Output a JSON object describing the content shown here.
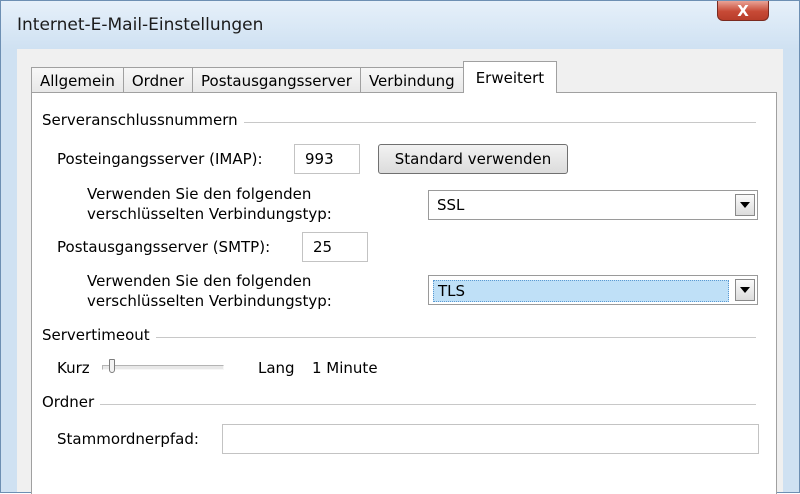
{
  "window": {
    "title": "Internet-E-Mail-Einstellungen",
    "close_symbol": "X"
  },
  "tabs": [
    {
      "label": "Allgemein"
    },
    {
      "label": "Ordner"
    },
    {
      "label": "Postausgangsserver"
    },
    {
      "label": "Verbindung"
    },
    {
      "label": "Erweitert",
      "active": true
    }
  ],
  "ports": {
    "group_title": "Serveranschlussnummern",
    "incoming_label": "Posteingangsserver (IMAP):",
    "incoming_value": "993",
    "default_button": "Standard verwenden",
    "incoming_enc_label_1": "Verwenden Sie den folgenden",
    "incoming_enc_label_2": "verschlüsselten Verbindungstyp:",
    "incoming_enc_value": "SSL",
    "outgoing_label": "Postausgangsserver (SMTP):",
    "outgoing_value": "25",
    "outgoing_enc_label_1": "Verwenden Sie den folgenden",
    "outgoing_enc_label_2": "verschlüsselten Verbindungstyp:",
    "outgoing_enc_value": "TLS"
  },
  "timeout": {
    "group_title": "Servertimeout",
    "short_label": "Kurz",
    "long_label": "Lang",
    "value_label": "1 Minute",
    "slider_level": 0.08
  },
  "folders": {
    "group_title": "Ordner",
    "root_path_label": "Stammordnerpfad:",
    "root_path_value": ""
  },
  "icons": {
    "dropdown": "chevron-down-icon",
    "close": "close-icon"
  },
  "colors": {
    "selection": "#bfe0f7",
    "titlebar": "#cfe1f2",
    "close_button": "#c74a36"
  }
}
